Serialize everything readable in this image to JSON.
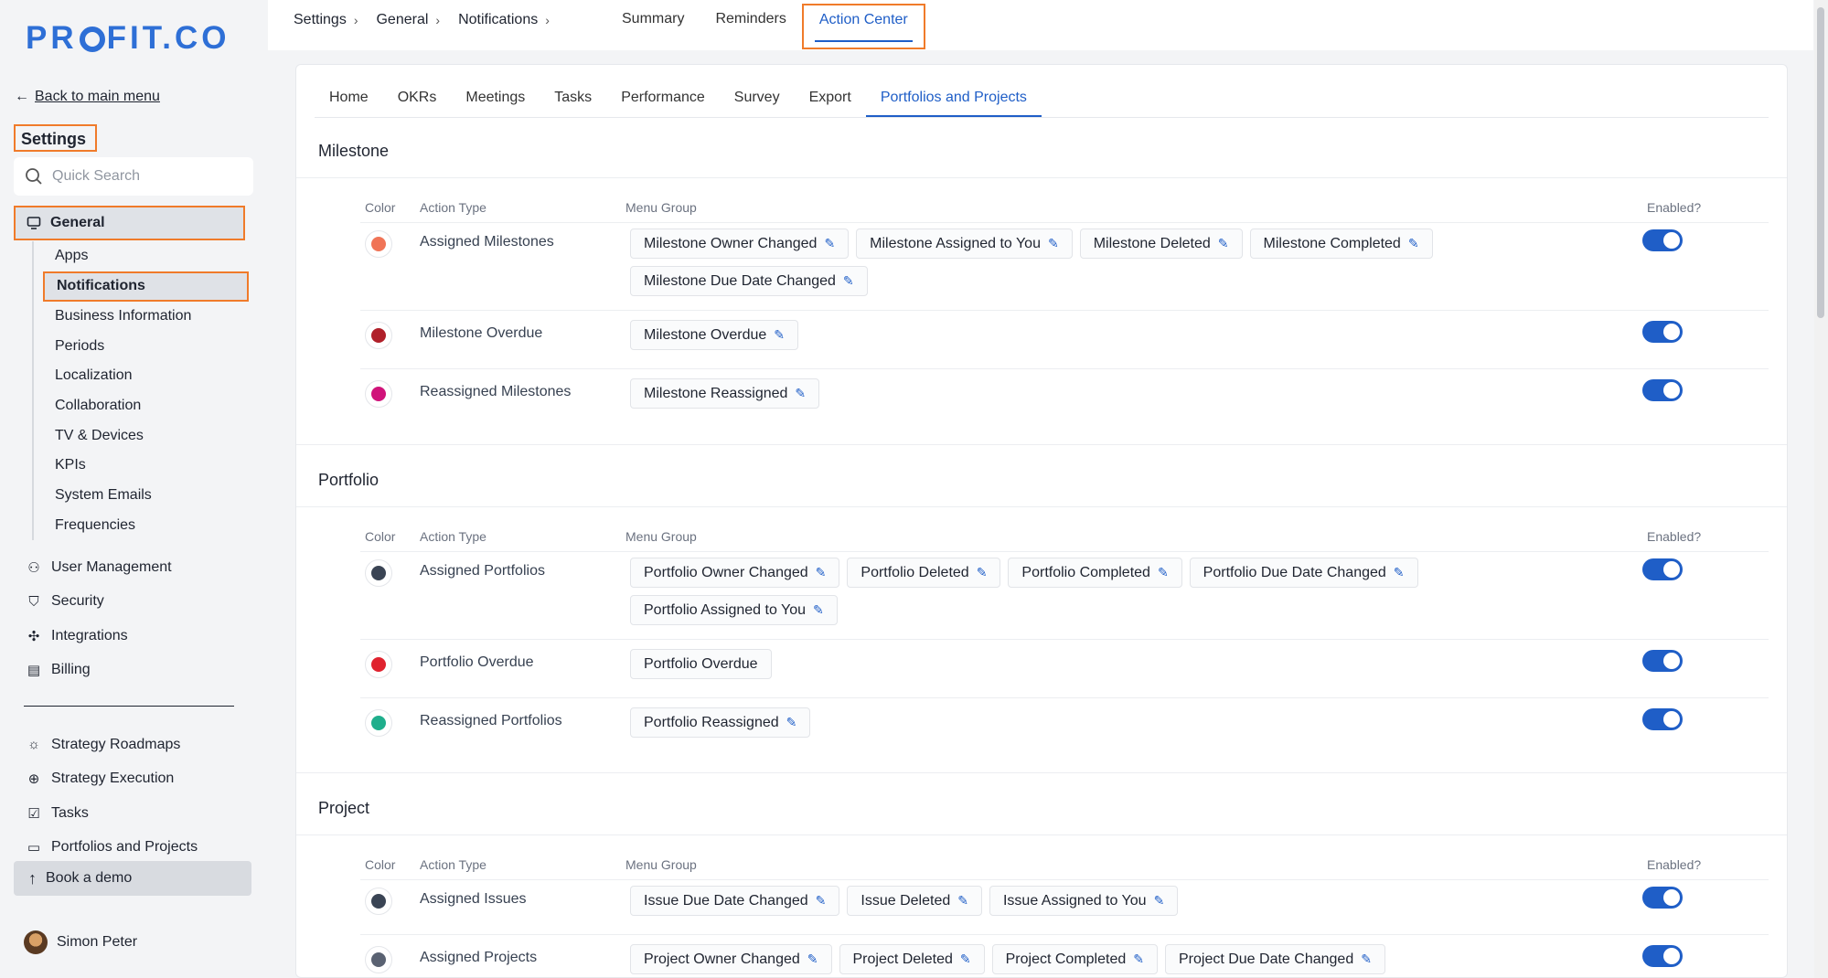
{
  "brand": {
    "logo_text_1": "PR",
    "logo_text_2": "FIT.CO"
  },
  "sidebar": {
    "back_label": "Back to main menu",
    "settings_title": "Settings",
    "search_placeholder": "Quick Search",
    "general_label": "General",
    "general_items": [
      "Apps",
      "Notifications",
      "Business Information",
      "Periods",
      "Localization",
      "Collaboration",
      "TV & Devices",
      "KPIs",
      "System Emails",
      "Frequencies"
    ],
    "active_item": "Notifications",
    "section_items": [
      {
        "label": "User Management",
        "icon": "user-icon"
      },
      {
        "label": "Security",
        "icon": "shield-icon"
      },
      {
        "label": "Integrations",
        "icon": "puzzle-icon"
      },
      {
        "label": "Billing",
        "icon": "receipt-icon"
      }
    ],
    "module_items": [
      {
        "label": "Strategy Roadmaps",
        "icon": "lightbulb-icon"
      },
      {
        "label": "Strategy Execution",
        "icon": "target-icon"
      },
      {
        "label": "Tasks",
        "icon": "clipboard-icon"
      },
      {
        "label": "Portfolios and Projects",
        "icon": "briefcase-icon"
      }
    ],
    "book_demo": "Book a demo",
    "user_name": "Simon Peter"
  },
  "topbar": {
    "breadcrumbs": [
      "Settings",
      "General",
      "Notifications"
    ],
    "tabs": [
      "Summary",
      "Reminders",
      "Action Center"
    ],
    "active_tab": "Action Center"
  },
  "subtabs": {
    "items": [
      "Home",
      "OKRs",
      "Meetings",
      "Tasks",
      "Performance",
      "Survey",
      "Export",
      "Portfolios and Projects"
    ],
    "active": "Portfolios and Projects"
  },
  "columns": {
    "color": "Color",
    "action_type": "Action Type",
    "menu_group": "Menu Group",
    "enabled": "Enabled?"
  },
  "sections": [
    {
      "title": "Milestone",
      "rows": [
        {
          "color": "#f07457",
          "action": "Assigned Milestones",
          "enabled": true,
          "chips": [
            {
              "label": "Milestone Owner Changed",
              "edit": true
            },
            {
              "label": "Milestone Assigned to You",
              "edit": true
            },
            {
              "label": "Milestone Deleted",
              "edit": true
            },
            {
              "label": "Milestone Completed",
              "edit": true
            },
            {
              "label": "Milestone Due Date Changed",
              "edit": true
            }
          ]
        },
        {
          "color": "#b0202a",
          "action": "Milestone Overdue",
          "enabled": true,
          "chips": [
            {
              "label": "Milestone Overdue",
              "edit": true
            }
          ]
        },
        {
          "color": "#d0137a",
          "action": "Reassigned Milestones",
          "enabled": true,
          "chips": [
            {
              "label": "Milestone Reassigned",
              "edit": true
            }
          ]
        }
      ]
    },
    {
      "title": "Portfolio",
      "rows": [
        {
          "color": "#3a4454",
          "action": "Assigned Portfolios",
          "enabled": true,
          "chips": [
            {
              "label": "Portfolio Owner Changed",
              "edit": true
            },
            {
              "label": "Portfolio Deleted",
              "edit": true
            },
            {
              "label": "Portfolio Completed",
              "edit": true
            },
            {
              "label": "Portfolio Due Date Changed",
              "edit": true
            },
            {
              "label": "Portfolio Assigned to You",
              "edit": true
            }
          ]
        },
        {
          "color": "#e0232f",
          "action": "Portfolio Overdue",
          "enabled": true,
          "chips": [
            {
              "label": "Portfolio Overdue",
              "edit": false
            }
          ]
        },
        {
          "color": "#1fae8c",
          "action": "Reassigned Portfolios",
          "enabled": true,
          "chips": [
            {
              "label": "Portfolio Reassigned",
              "edit": true
            }
          ]
        }
      ]
    },
    {
      "title": "Project",
      "rows": [
        {
          "color": "#3a4454",
          "action": "Assigned Issues",
          "enabled": true,
          "chips": [
            {
              "label": "Issue Due Date Changed",
              "edit": true
            },
            {
              "label": "Issue Deleted",
              "edit": true
            },
            {
              "label": "Issue Assigned to You",
              "edit": true
            }
          ]
        },
        {
          "color": "#5a6272",
          "action": "Assigned Projects",
          "enabled": true,
          "chips": [
            {
              "label": "Project Owner Changed",
              "edit": true
            },
            {
              "label": "Project Deleted",
              "edit": true
            },
            {
              "label": "Project Completed",
              "edit": true
            },
            {
              "label": "Project Due Date Changed",
              "edit": true
            }
          ]
        }
      ]
    }
  ],
  "accent_color": "#1f5ec7",
  "highlight_color": "#f07b2a"
}
